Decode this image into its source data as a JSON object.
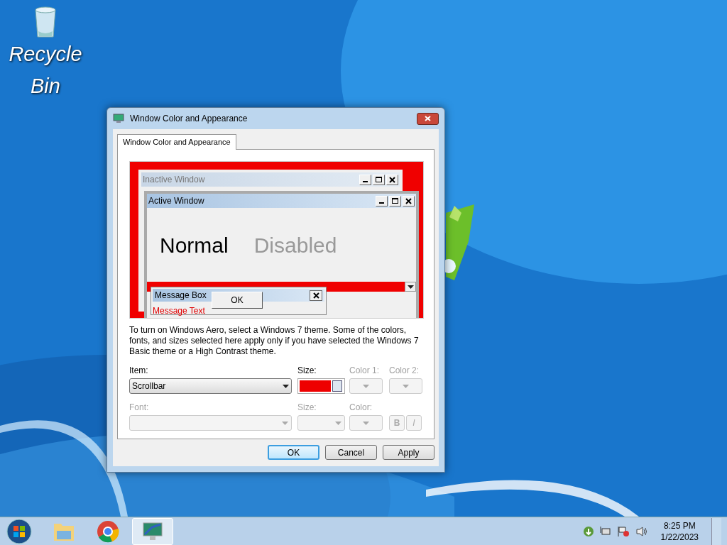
{
  "desktop_icons": [
    {
      "label": "Recycle Bin"
    }
  ],
  "dialog": {
    "title": "Window Color and Appearance",
    "tabs": [
      {
        "label": "Window Color and Appearance",
        "selected": true
      }
    ],
    "preview": {
      "inactive_title": "Inactive Window",
      "active_title": "Active Window",
      "normal": "Normal",
      "disabled": "Disabled",
      "message_box_title": "Message Box",
      "message_ok": "OK",
      "message_text": "Message Text"
    },
    "description": "To turn on Windows Aero, select a Windows 7 theme.  Some of the colors, fonts, and sizes selected here apply only if you have selected the Windows 7 Basic theme or a High Contrast theme.",
    "item": {
      "label": "Item:",
      "value": "Scrollbar"
    },
    "size": {
      "label": "Size:",
      "color": "#ee0000"
    },
    "color1": {
      "label": "Color 1:",
      "disabled": true
    },
    "color2": {
      "label": "Color 2:",
      "disabled": true
    },
    "font": {
      "label": "Font:",
      "disabled": true
    },
    "font_size": {
      "label": "Size:",
      "disabled": true
    },
    "font_color": {
      "label": "Color:",
      "disabled": true
    },
    "bold": {
      "label": "B",
      "disabled": true
    },
    "italic": {
      "label": "I",
      "disabled": true
    },
    "buttons": [
      {
        "label": "OK",
        "default": true
      },
      {
        "label": "Cancel",
        "default": false
      },
      {
        "label": "Apply",
        "default": false
      }
    ]
  },
  "taskbar": {
    "time": "8:25 PM",
    "date": "1/22/2023"
  }
}
